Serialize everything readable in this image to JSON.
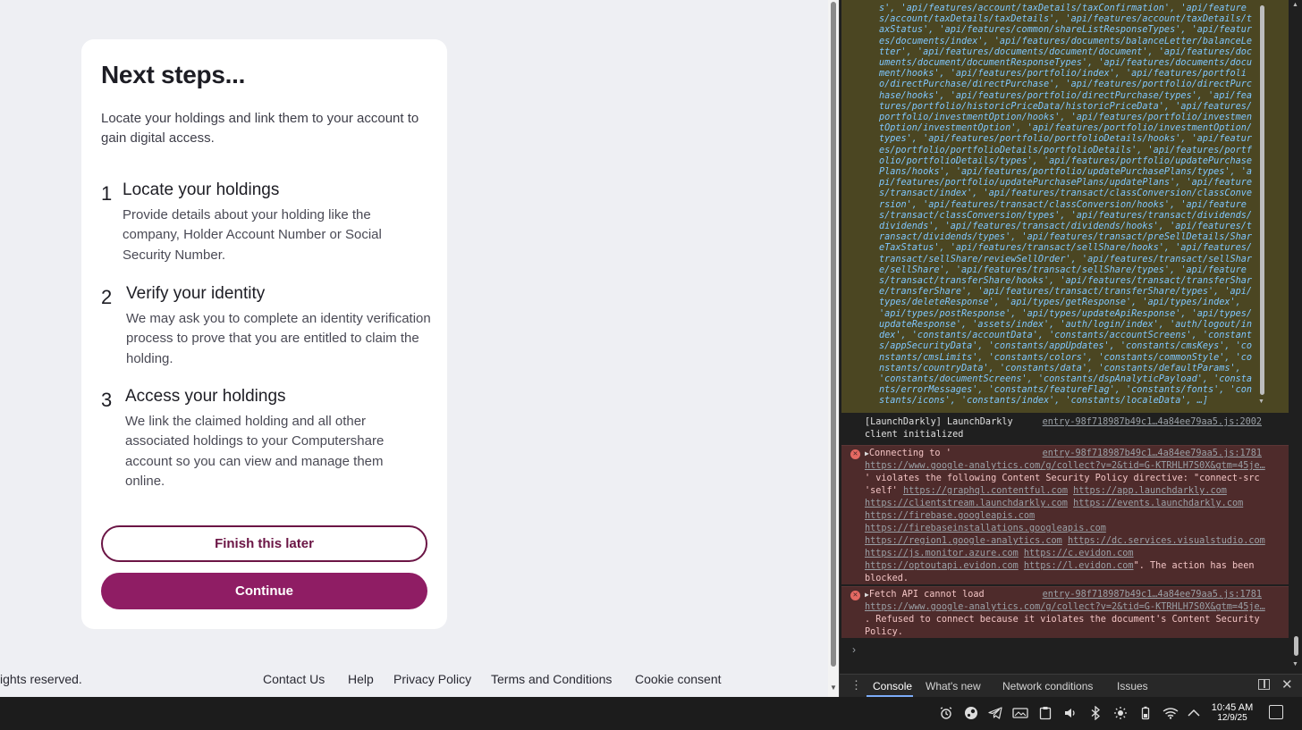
{
  "card": {
    "heading": "Next steps...",
    "intro": "Locate your holdings and link them to your account to gain digital access.",
    "steps": [
      {
        "num": "1",
        "title": "Locate your holdings",
        "desc": "Provide details about your holding like the company, Holder Account Number or Social Security Number."
      },
      {
        "num": "2",
        "title": "Verify your identity",
        "desc": "We may ask you to complete an identity verification process to prove that you are entitled to claim the holding."
      },
      {
        "num": "3",
        "title": "Access your holdings",
        "desc": "We link the claimed holding and all other associated holdings to your Computershare account so you can view and manage them online."
      }
    ],
    "finish_later_label": "Finish this later",
    "continue_label": "Continue"
  },
  "footer": {
    "copyright": "ights reserved.",
    "links": [
      "Contact Us",
      "Help",
      "Privacy Policy",
      "Terms and Conditions",
      "Cookie consent"
    ]
  },
  "devtools": {
    "array_text": "s', 'api/features/account/taxDetails/taxConfirmation', 'api/features/account/taxDetails/taxDetails', 'api/features/account/taxDetails/taxStatus', 'api/features/common/shareListResponseTypes', 'api/features/documents/index', 'api/features/documents/balanceLetter/balanceLetter', 'api/features/documents/document/document', 'api/features/documents/document/documentResponseTypes', 'api/features/documents/document/hooks', 'api/features/portfolio/index', 'api/features/portfolio/directPurchase/directPurchase', 'api/features/portfolio/directPurchase/hooks', 'api/features/portfolio/directPurchase/types', 'api/features/portfolio/historicPriceData/historicPriceData', 'api/features/portfolio/investmentOption/hooks', 'api/features/portfolio/investmentOption/investmentOption', 'api/features/portfolio/investmentOption/types', 'api/features/portfolio/portfolioDetails/hooks', 'api/features/portfolio/portfolioDetails/portfolioDetails', 'api/features/portfolio/portfolioDetails/types', 'api/features/portfolio/updatePurchasePlans/hooks', 'api/features/portfolio/updatePurchasePlans/types', 'api/features/portfolio/updatePurchasePlans/updatePlans', 'api/features/transact/index', 'api/features/transact/classConversion/classConversion', 'api/features/transact/classConversion/hooks', 'api/features/transact/classConversion/types', 'api/features/transact/dividends/dividends', 'api/features/transact/dividends/hooks', 'api/features/transact/dividends/types', 'api/features/transact/preSellDetails/ShareTaxStatus', 'api/features/transact/sellShare/hooks', 'api/features/transact/sellShare/reviewSellOrder', 'api/features/transact/sellShare/sellShare', 'api/features/transact/sellShare/types', 'api/features/transact/transferShare/hooks', 'api/features/transact/transferShare/transferShare', 'api/features/transact/transferShare/types', 'api/types/deleteResponse', 'api/types/getResponse', 'api/types/index', 'api/types/postResponse', 'api/types/updateApiResponse', 'api/types/updateResponse', 'assets/index', 'auth/login/index', 'auth/logout/index', 'constants/accountData', 'constants/accountScreens', 'constants/appSecurityData', 'constants/appUpdates', 'constants/cmsKeys', 'constants/cmsLimits', 'constants/colors', 'constants/commonStyle', 'constants/countryData', 'constants/data', 'constants/defaultParams', 'constants/documentScreens', 'constants/dspAnalyticPayload', 'constants/errorMessages', 'constants/featureFlag', 'constants/fonts', 'constants/icons', 'constants/index', 'constants/localeData', …]",
    "info_msg": "[LaunchDarkly] LaunchDarkly client initialized",
    "info_src": "entry-98f718987b49c1…4a84ee79aa5.js:2002",
    "err1_prefix": "Connecting to '",
    "err1_url": "https://www.google-analytics.com/g/collect?v=2&tid=G-KTRHLH7S0X&gtm=45je…",
    "err1_mid": "' violates the following Content Security Policy directive: \"connect-src 'self'",
    "err1_links": [
      "https://graphql.contentful.com",
      "https://app.launchdarkly.com",
      "https://clientstream.launchdarkly.com",
      "https://events.launchdarkly.com",
      "https://firebase.googleapis.com",
      "https://firebaseinstallations.googleapis.com",
      "https://region1.google-analytics.com",
      "https://dc.services.visualstudio.com",
      "https://js.monitor.azure.com",
      "https://c.evidon.com",
      "https://optoutapi.evidon.com",
      "https://l.evidon.com"
    ],
    "err1_suffix": "\". The action has been blocked.",
    "err1_src": "entry-98f718987b49c1…4a84ee79aa5.js:1781",
    "err2_prefix": "Fetch API cannot load",
    "err2_url": "https://www.google-analytics.com/g/collect?v=2&tid=G-KTRHLH7S0X&gtm=45je…",
    "err2_suffix": ". Refused to connect because it violates the document's Content Security Policy.",
    "err2_src": "entry-98f718987b49c1…4a84ee79aa5.js:1781",
    "tabs": [
      "Console",
      "What's new",
      "Network conditions",
      "Issues"
    ]
  },
  "taskbar": {
    "time": "10:45 AM",
    "date": "12/9/25"
  }
}
